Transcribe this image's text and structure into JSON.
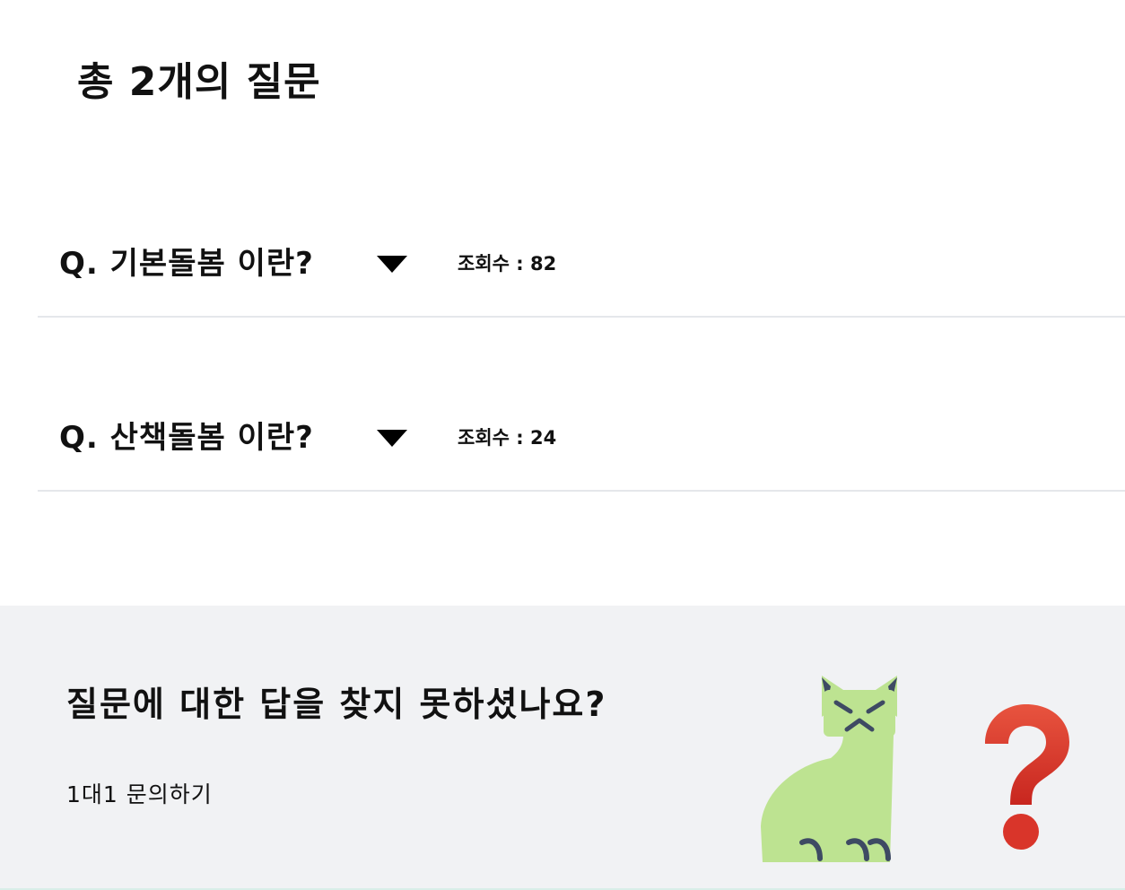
{
  "page": {
    "title": "총 2개의 질문"
  },
  "faq": {
    "items": [
      {
        "question": "Q. 기본돌봄 이란?",
        "views": "조회수 : 82"
      },
      {
        "question": "Q. 산책돌봄 이란?",
        "views": "조회수 : 24"
      }
    ]
  },
  "help": {
    "heading": "질문에 대한 답을 찾지 못하셨나요?",
    "link_label": "1대1 문의하기"
  },
  "icons": {
    "expand": "caret-down-icon",
    "cat": "cat-illustration",
    "question": "question-mark-icon"
  },
  "colors": {
    "background": "#ffffff",
    "help_background": "#f1f2f4",
    "divider": "#e5e7eb",
    "cat": "#bde391",
    "question_mark": "#d63a2b"
  }
}
